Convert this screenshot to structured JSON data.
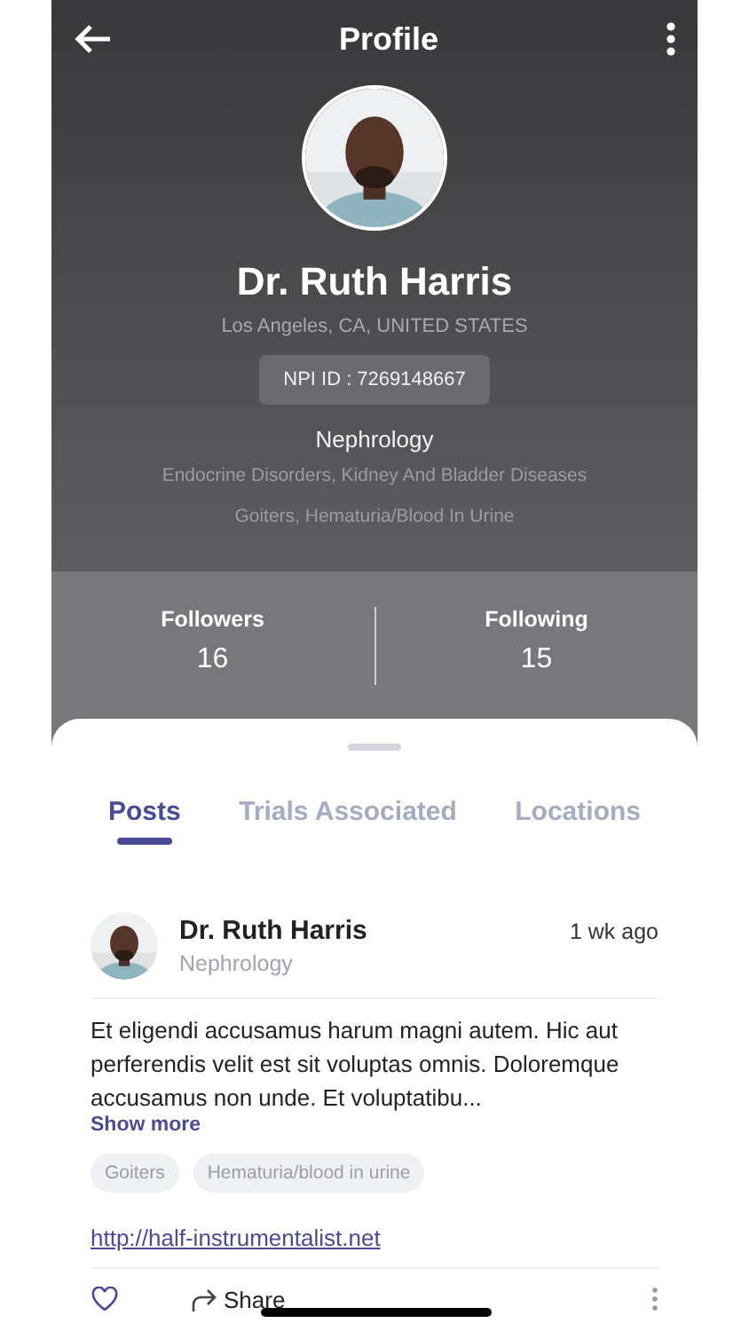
{
  "header": {
    "title": "Profile"
  },
  "profile": {
    "name": "Dr. Ruth Harris",
    "location": "Los Angeles, CA, UNITED STATES",
    "npi": "NPI ID : 7269148667",
    "specialty": "Nephrology",
    "subspecialties": [
      "Endocrine Disorders, Kidney And Bladder Diseases",
      "Goiters, Hematuria/Blood In Urine"
    ]
  },
  "stats": [
    {
      "label": "Followers",
      "value": "16"
    },
    {
      "label": "Following",
      "value": "15"
    }
  ],
  "tabs": [
    {
      "label": "Posts",
      "selected": true
    },
    {
      "label": "Trials Associated",
      "selected": false
    },
    {
      "label": "Locations",
      "selected": false
    }
  ],
  "post": {
    "author": "Dr. Ruth Harris",
    "specialty": "Nephrology",
    "time": "1 wk ago",
    "body": "Et eligendi accusamus harum magni autem. Hic aut perferendis velit est sit voluptas omnis. Doloremque accusamus non unde. Et voluptatibu...",
    "show_more": "Show more",
    "tags": [
      "Goiters",
      "Hematuria/blood in urine"
    ],
    "link": "http://half-instrumentalist.net",
    "share": "Share"
  }
}
